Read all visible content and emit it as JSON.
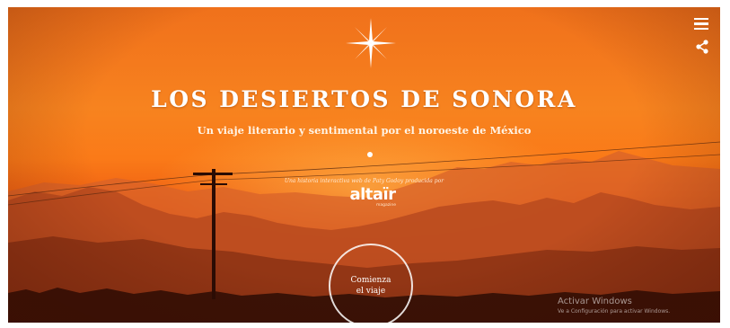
{
  "hero": {
    "title": "LOS DESIERTOS DE SONORA",
    "subtitle": "Un viaje literario y sentimental por el noroeste de México",
    "credit": "Una historia interactiva web de Paty Godoy producida por",
    "logo_word": "altaïr",
    "logo_sub": "magazine",
    "start_line1": "Comienza",
    "start_line2": "el viaje"
  },
  "toolbar": {
    "menu_icon": "hamburger-menu-icon",
    "share_icon": "share-icon"
  },
  "watermark": {
    "title": "Activar Windows",
    "subtitle": "Ve a Configuración para activar Windows."
  },
  "colors": {
    "sky_top": "#f0711b",
    "sky_glow": "#fa7a18",
    "mountains": "#b44a1c",
    "foreground": "#3a1206",
    "text": "#ffffff"
  }
}
